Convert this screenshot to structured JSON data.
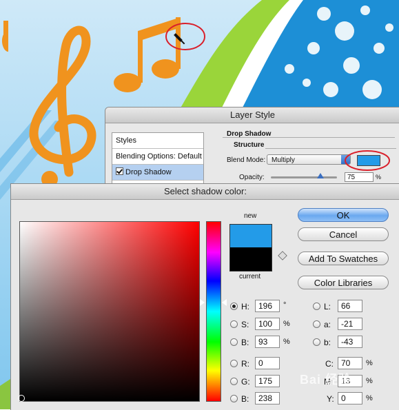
{
  "layer_style": {
    "title": "Layer Style",
    "styles_header": "Styles",
    "blending_options": "Blending Options: Default",
    "drop_shadow_item": "Drop Shadow",
    "section_title": "Drop Shadow",
    "structure_title": "Structure",
    "blend_mode_label": "Blend Mode:",
    "blend_mode_value": "Multiply",
    "opacity_label": "Opacity:",
    "opacity_value": "75",
    "opacity_unit": "%",
    "shadow_color": "#239be8"
  },
  "color_picker": {
    "title": "Select shadow color:",
    "new_label": "new",
    "current_label": "current",
    "new_color": "#239be8",
    "current_color": "#000000",
    "buttons": {
      "ok": "OK",
      "cancel": "Cancel",
      "add_to_swatches": "Add To Swatches",
      "color_libraries": "Color Libraries"
    },
    "hsb": {
      "h_label": "H:",
      "h_value": "196",
      "h_unit": "°",
      "s_label": "S:",
      "s_value": "100",
      "s_unit": "%",
      "b_label": "B:",
      "b_value": "93",
      "b_unit": "%"
    },
    "lab": {
      "l_label": "L:",
      "l_value": "66",
      "a_label": "a:",
      "a_value": "-21",
      "b_label": "b:",
      "b_value": "-43"
    },
    "rgb": {
      "r_label": "R:",
      "r_value": "0",
      "g_label": "G:",
      "g_value": "175",
      "b_label": "B:",
      "b_value": "238"
    },
    "cmyk": {
      "c_label": "C:",
      "c_value": "70",
      "c_unit": "%",
      "m_label": "M:",
      "m_value": "13",
      "m_unit": "%",
      "y_label": "Y:",
      "y_value": "0",
      "y_unit": "%"
    },
    "selected_mode": "H"
  },
  "watermark": "Bai 经验"
}
